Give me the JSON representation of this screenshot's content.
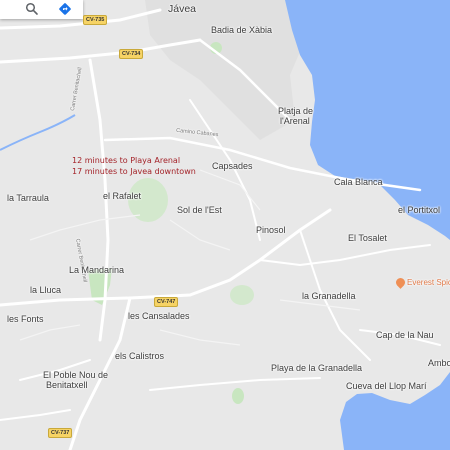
{
  "toolbar": {
    "search_icon": "search-icon",
    "directions_icon": "directions-icon"
  },
  "note": {
    "line1": "12 minutes to Playa Arenal",
    "line2": "17 minutes to Javea downtown"
  },
  "places": {
    "javea": "Jávea",
    "badia": "Badia de Xàbia",
    "platja_arenal_1": "Platja de",
    "platja_arenal_2": "l'Arenal",
    "capsades": "Capsades",
    "cala_blanca": "Cala Blanca",
    "la_tarraula": "la Tarraula",
    "el_rafalet": "el Rafalet",
    "sol_de_lest": "Sol de l'Est",
    "el_portitxol": "el Portitxol",
    "pinosol": "Pinosol",
    "el_tosalet": "El Tosalet",
    "la_mandarina": "La Mandarina",
    "everest": "Everest Spic",
    "la_lluca": "la Lluca",
    "la_granadella": "la Granadella",
    "les_fonts": "les Fonts",
    "les_cansalades": "les Cansalades",
    "cap_de_la_nau": "Cap de la Nau",
    "els_calistros": "els Calistros",
    "ambolo": "Ambol",
    "poble_nou_1": "El Poble Nou de",
    "poble_nou_2": "Benitatxell",
    "playa_granadella": "Playa de la Granadella",
    "cueva": "Cueva del Llop Marí"
  },
  "roads": {
    "cami_cabanes": "Camino Cabanes",
    "carrer_benitachell": "Carrer Benitachell",
    "carrer_benitachell_2": "Carrer Benitachell"
  },
  "shields": {
    "cv735": "CV-735",
    "cv734": "CV-734",
    "cv747": "CV-747",
    "cv737": "CV-737"
  },
  "colors": {
    "land": "#e8e8e8",
    "water": "#8ab4f8",
    "park": "#c8e6c0",
    "road": "#ffffff",
    "note_text": "#a4242a",
    "shield_bg": "#f6d365",
    "poi": "#ef8f55"
  }
}
